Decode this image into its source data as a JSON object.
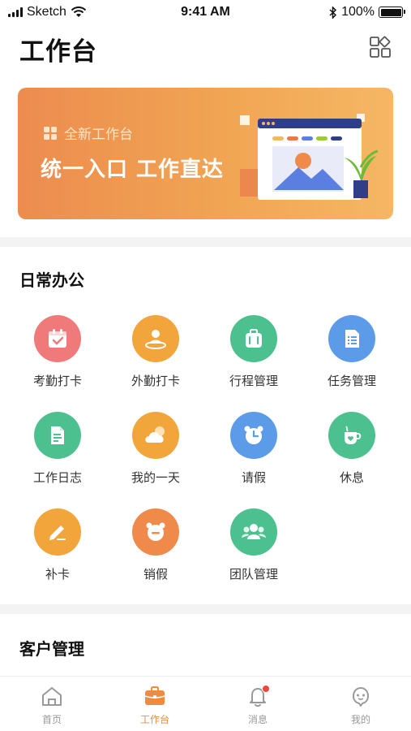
{
  "status_bar": {
    "carrier": "Sketch",
    "time": "9:41 AM",
    "battery": "100%"
  },
  "header": {
    "title": "工作台",
    "grid_icon": "grid-icon"
  },
  "banner": {
    "subtitle": "全新工作台",
    "headline": "统一入口  工作直达"
  },
  "sections": {
    "daily": {
      "title": "日常办公",
      "items": [
        {
          "label": "考勤打卡",
          "icon": "calendar-check-icon",
          "color": "#f07a7a"
        },
        {
          "label": "外勤打卡",
          "icon": "location-person-icon",
          "color": "#f2a53a"
        },
        {
          "label": "行程管理",
          "icon": "luggage-icon",
          "color": "#4dc08f"
        },
        {
          "label": "任务管理",
          "icon": "task-list-icon",
          "color": "#5b9be8"
        },
        {
          "label": "工作日志",
          "icon": "document-icon",
          "color": "#4dc08f"
        },
        {
          "label": "我的一天",
          "icon": "cloud-sun-icon",
          "color": "#f2a53a"
        },
        {
          "label": "请假",
          "icon": "alarm-clock-icon",
          "color": "#5b9be8"
        },
        {
          "label": "休息",
          "icon": "coffee-cup-icon",
          "color": "#4dc08f"
        },
        {
          "label": "补卡",
          "icon": "pencil-icon",
          "color": "#f2a53a"
        },
        {
          "label": "销假",
          "icon": "alarm-cancel-icon",
          "color": "#f08a4a"
        },
        {
          "label": "团队管理",
          "icon": "team-icon",
          "color": "#4dc08f"
        }
      ]
    },
    "customer": {
      "title": "客户管理"
    }
  },
  "tab_bar": {
    "active": "工作台",
    "accent": "#ef8b3f",
    "items": [
      {
        "label": "首页",
        "icon": "home-icon"
      },
      {
        "label": "工作台",
        "icon": "briefcase-icon"
      },
      {
        "label": "消息",
        "icon": "bell-icon"
      },
      {
        "label": "我的",
        "icon": "user-face-icon"
      }
    ]
  }
}
